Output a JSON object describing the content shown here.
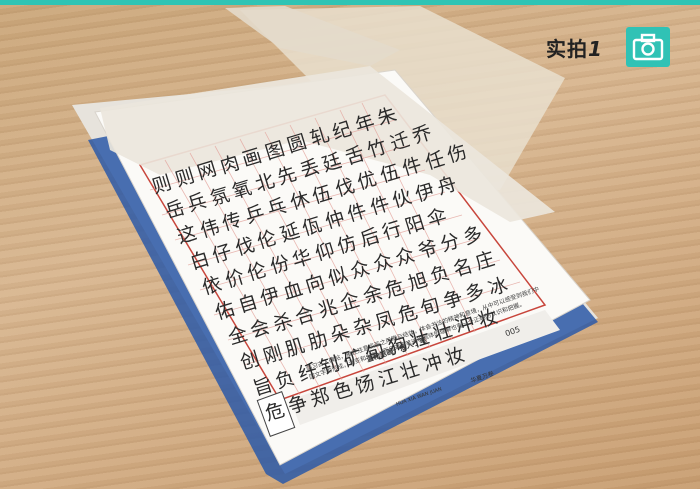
{
  "badge": {
    "label": "实拍",
    "number": "1",
    "icon": "camera-icon",
    "accent_color": "#30c2b5"
  },
  "worksheet": {
    "grid_rows": [
      [
        "则",
        "则",
        "网",
        "肉",
        "画",
        "图",
        "圆",
        "轧",
        "纪",
        "年",
        "朱"
      ],
      [
        "岳",
        "兵",
        "氛",
        "氧",
        "北",
        "先",
        "丢",
        "廷",
        "舌",
        "竹",
        "迁",
        "乔"
      ],
      [
        "这",
        "伟",
        "传",
        "乒",
        "乓",
        "休",
        "伍",
        "伐",
        "优",
        "伍",
        "件",
        "任",
        "伤"
      ],
      [
        "白",
        "仔",
        "伐",
        "伦",
        "延",
        "佤",
        "仲",
        "件",
        "件",
        "伙",
        "伊",
        "舟"
      ],
      [
        "依",
        "价",
        "伦",
        "份",
        "华",
        "仰",
        "仿",
        "后",
        "行",
        "阳",
        "伞"
      ],
      [
        "佑",
        "自",
        "伊",
        "血",
        "向",
        "似",
        "众",
        "众",
        "众",
        "爷",
        "分",
        "多"
      ],
      [
        "全",
        "会",
        "杀",
        "合",
        "兆",
        "企",
        "余",
        "危",
        "旭",
        "负",
        "名",
        "庄"
      ],
      [
        "创",
        "刚",
        "肌",
        "肋",
        "朵",
        "杂",
        "凤",
        "危",
        "旬",
        "争",
        "多",
        "冰"
      ],
      [
        "旨",
        "负",
        "纤",
        "钊",
        "矿",
        "旬",
        "狗",
        "壮",
        "壮",
        "冲",
        "妆"
      ],
      [
        "危",
        "争",
        "郑",
        "色",
        "饧",
        "江",
        "壮",
        "冲",
        "妆"
      ]
    ],
    "footer_title": "温和笔画，摇入丁笔",
    "page_number": "005",
    "footer_body": "临习古人碑帖，重在注意点画之用笔与结体，体会书法的精神和意境，从中可以感受到我们中国文字的形成，演变和发展，而且对于笔法和结体的理解也有一个正确的认识和把握。",
    "brand_pinyin": "HUA XIA WAN JUAN",
    "brand_name": "华夏万卷"
  }
}
